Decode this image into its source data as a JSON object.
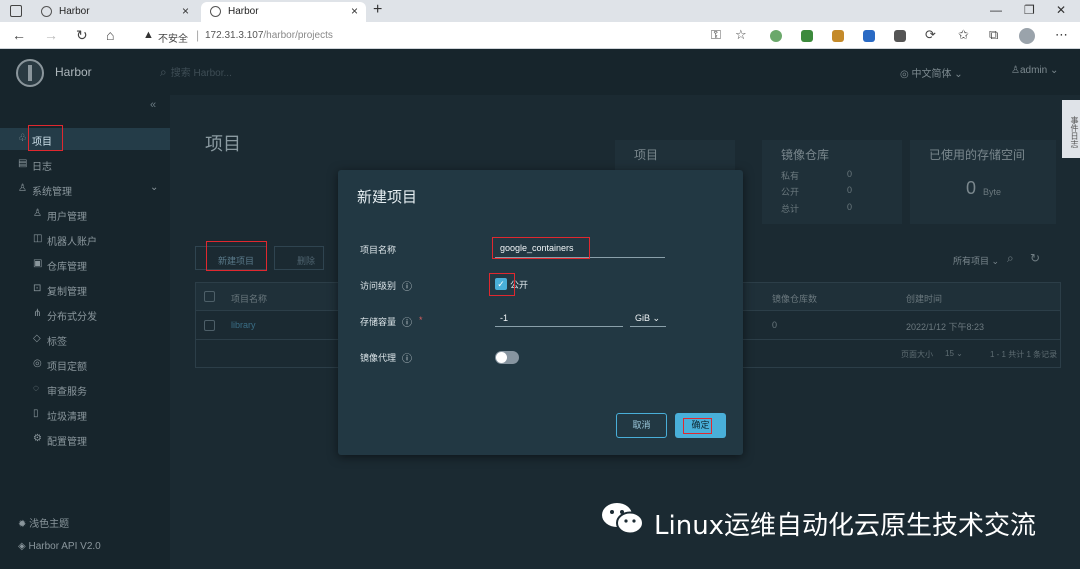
{
  "browser": {
    "tabs": [
      {
        "title": "Harbor",
        "close": "×"
      },
      {
        "title": "Harbor",
        "close": "×"
      }
    ],
    "new_tab": "+",
    "window_controls": {
      "min": "—",
      "max": "❐",
      "close": "✕"
    },
    "address": {
      "warning": "不安全",
      "host": "172.31.3.107",
      "path": "/harbor/projects"
    }
  },
  "header": {
    "brand": "Harbor",
    "search_placeholder": "搜索 Harbor...",
    "language": "中文简体",
    "user": "admin"
  },
  "sidebar": {
    "items": [
      {
        "label": "项目",
        "icon": "projects-icon"
      },
      {
        "label": "日志",
        "icon": "logs-icon"
      },
      {
        "label": "系统管理",
        "icon": "admin-icon"
      }
    ],
    "subitems": [
      {
        "label": "用户管理"
      },
      {
        "label": "机器人账户"
      },
      {
        "label": "仓库管理"
      },
      {
        "label": "复制管理"
      },
      {
        "label": "分布式分发"
      },
      {
        "label": "标签"
      },
      {
        "label": "项目定额"
      },
      {
        "label": "审查服务"
      },
      {
        "label": "垃圾清理"
      },
      {
        "label": "配置管理"
      }
    ],
    "theme": "浅色主题",
    "api": "Harbor API V2.0"
  },
  "main": {
    "title": "项目",
    "stats": {
      "projects_title": "项目",
      "repos_title": "镜像仓库",
      "storage_title": "已使用的存储空间",
      "rows": [
        {
          "label": "私有",
          "value": "0"
        },
        {
          "label": "公开",
          "value": "0"
        },
        {
          "label": "总计",
          "value": "0"
        }
      ],
      "storage_value": "0",
      "storage_unit": "Byte"
    },
    "toolbar": {
      "new_project": "新建项目",
      "delete": "删除",
      "filter": "所有项目"
    },
    "table": {
      "headers": [
        "项目名称",
        "镜像仓库数",
        "创建时间"
      ],
      "rows": [
        {
          "name": "library",
          "repos": "0",
          "created": "2022/1/12 下午8:23"
        }
      ],
      "footer": {
        "page_size_label": "页面大小",
        "page_size": "15",
        "total": "1 - 1 共计 1 条记录"
      }
    },
    "side_tab": "事件日志"
  },
  "modal": {
    "title": "新建项目",
    "project_name_label": "项目名称",
    "project_name_value": "google_containers",
    "access_label": "访问级别",
    "public_label": "公开",
    "storage_label": "存储容量",
    "storage_value": "-1",
    "storage_unit": "GiB",
    "proxy_label": "镜像代理",
    "cancel": "取消",
    "ok": "确定"
  },
  "watermark": "Linux运维自动化云原生技术交流"
}
